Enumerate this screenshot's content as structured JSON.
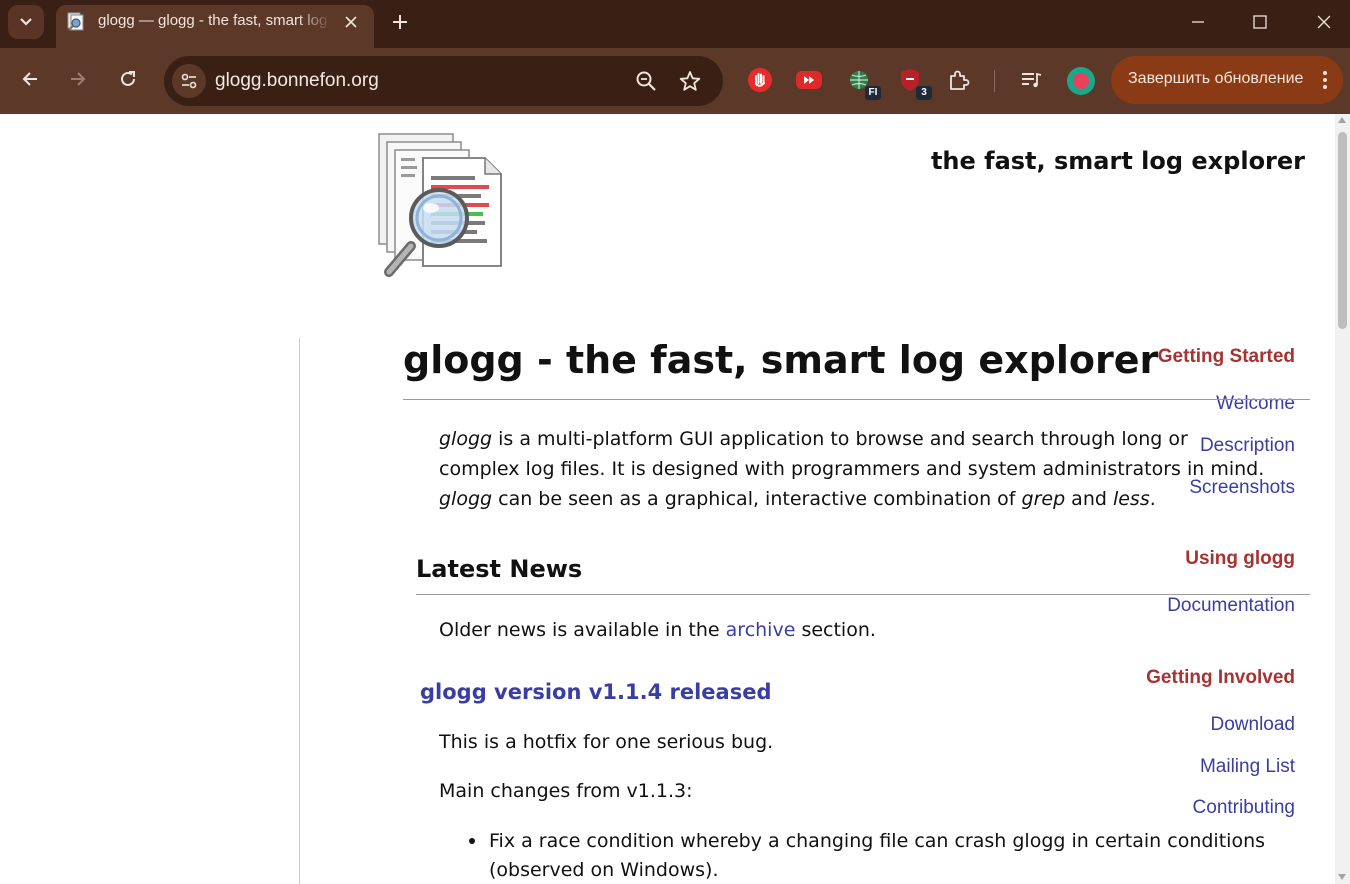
{
  "tab": {
    "title": "glogg — glogg - the fast, smart log explorer"
  },
  "omnibox": {
    "url": "glogg.bonnefon.org"
  },
  "toolbar": {
    "update_label": "Завершить обновление",
    "extensions": [
      {
        "icon": "stop-hand-icon"
      },
      {
        "icon": "youtube-forward-icon"
      },
      {
        "icon": "globe-translate-icon",
        "badge": "FI"
      },
      {
        "icon": "shield-icon",
        "badge": "3"
      },
      {
        "icon": "puzzle-icon"
      },
      {
        "icon": "playlist-icon"
      }
    ]
  },
  "page": {
    "tagline": "the fast, smart log explorer",
    "sidebar": {
      "sections": [
        {
          "heading": "Getting Started",
          "links": [
            "Welcome",
            "Description",
            "Screenshots"
          ]
        },
        {
          "heading": "Using glogg",
          "links": [
            "Documentation"
          ]
        },
        {
          "heading": "Getting Involved",
          "links": [
            "Download",
            "Mailing List",
            "Contributing"
          ]
        }
      ]
    },
    "title": "glogg - the fast, smart log explorer",
    "intro": {
      "line1_em": "glogg",
      "line1_rest": " is a multi-platform GUI application to browse and search through long or",
      "line2": "complex log files. It is designed with programmers and system administrators in mind.",
      "line3_em1": "glogg",
      "line3_mid": " can be seen as a graphical, interactive combination of ",
      "line3_em2": "grep",
      "line3_and": " and ",
      "line3_em3": "less",
      "line3_end": "."
    },
    "latest_news": {
      "heading": "Latest News",
      "archive_prefix": "Older news is available in the ",
      "archive_link": "archive",
      "archive_suffix": " section.",
      "item_title": "glogg version v1.1.4 released",
      "item_p1": "This is a hotfix for one serious bug.",
      "item_p2": "Main changes from v1.1.3:",
      "bullet_line1": "Fix a race condition whereby a changing file can crash glogg in certain conditions",
      "bullet_line2": "(observed on Windows)."
    }
  },
  "colors": {
    "chrome_dark": "#3a1f15",
    "chrome_tab": "#5c3829",
    "update_button": "#8a3b15",
    "sidebar_heading": "#a83232",
    "link": "#3a3da3"
  }
}
